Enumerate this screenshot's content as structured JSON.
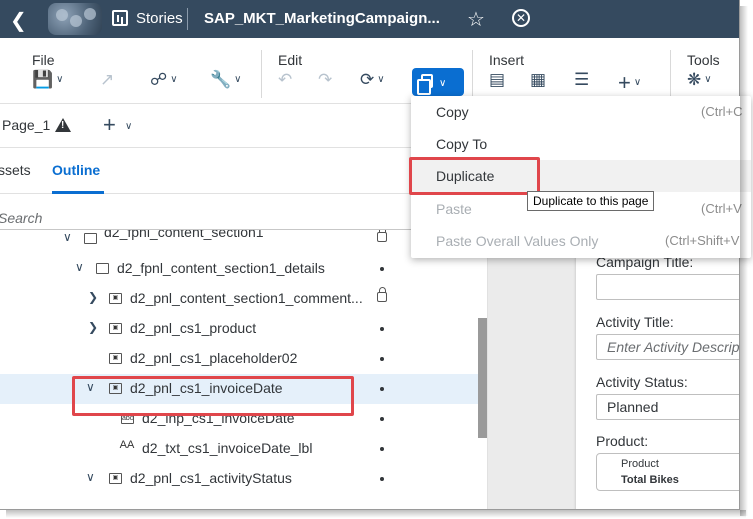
{
  "shell": {
    "app_name": "Stories",
    "document_title": "SAP_MKT_MarketingCampaign..."
  },
  "toolbar": {
    "groups": {
      "file": "File",
      "edit": "Edit",
      "insert": "Insert",
      "tools": "Tools"
    }
  },
  "pagebar": {
    "page_name": "Page_1"
  },
  "left_panel": {
    "tabs": {
      "assets": "ssets",
      "outline": "Outline"
    },
    "search_placeholder": "Search",
    "tree": [
      {
        "label": "d2_fpnl_content_section1"
      },
      {
        "label": "d2_fpnl_content_section1_details"
      },
      {
        "label": "d2_pnl_content_section1_comment..."
      },
      {
        "label": "d2_pnl_cs1_product"
      },
      {
        "label": "d2_pnl_cs1_placeholder02"
      },
      {
        "label": "d2_pnl_cs1_invoiceDate"
      },
      {
        "label": "d2_inp_cs1_invoiceDate"
      },
      {
        "label": "d2_txt_cs1_invoiceDate_lbl"
      },
      {
        "label": "d2_pnl_cs1_activityStatus"
      }
    ],
    "icon_abbr": {
      "panel": "▭",
      "input": "abc",
      "text": "AA"
    }
  },
  "canvas": {
    "campaign_title_label": "Campaign Title:",
    "activity_title_label": "Activity Title:",
    "activity_title_placeholder": "Enter Activity Descrip",
    "activity_status_label": "Activity Status:",
    "activity_status_value": "Planned",
    "product_label": "Product:",
    "product_tile_title": "Product",
    "product_tile_value": "Total Bikes"
  },
  "menu": {
    "items": [
      {
        "label": "Copy",
        "shortcut": "(Ctrl+C"
      },
      {
        "label": "Copy To",
        "shortcut": ""
      },
      {
        "label": "Duplicate",
        "shortcut": ""
      },
      {
        "label": "Paste",
        "shortcut": "(Ctrl+V"
      },
      {
        "label": "Paste Overall Values Only",
        "shortcut": "(Ctrl+Shift+V"
      }
    ]
  },
  "tooltip": "Duplicate to this page",
  "colors": {
    "shell": "#354a5f",
    "accent": "#0a6ed1",
    "highlight": "#e0464b"
  }
}
